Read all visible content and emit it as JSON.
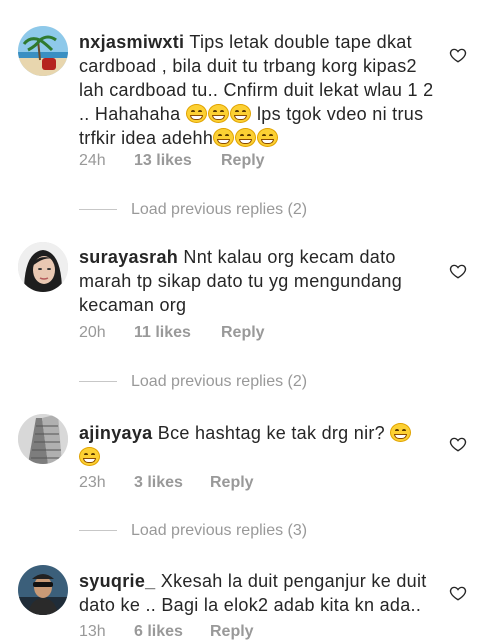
{
  "comments": [
    {
      "username": "nxjasmiwxti",
      "segments": [
        "Tips letak double tape dkat cardboad , bila duit tu trbang korg kipas2 lah cardboad tu.. Cnfirm duit lekat wlau 1 2 .. Hahahaha ",
        "emoji",
        "emoji",
        "emoji",
        " lps tgok vdeo ni trus trfkir idea adehh",
        "emoji",
        "emoji",
        "emoji"
      ],
      "time": "24h",
      "likes": "13 likes",
      "reply": "Reply",
      "avatar_icon": "beach-photo-avatar"
    },
    {
      "username": "surayasrah",
      "segments": [
        "Nnt kalau org kecam dato marah tp sikap dato tu yg mengundang kecaman org"
      ],
      "time": "20h",
      "likes": "11 likes",
      "reply": "Reply",
      "avatar_icon": "woman-portrait-avatar"
    },
    {
      "username": "ajinyaya",
      "segments": [
        "Bce hashtag ke tak drg nir? ",
        "emoji",
        " ",
        "emoji"
      ],
      "time": "23h",
      "likes": "3 likes",
      "reply": "Reply",
      "avatar_icon": "building-photo-avatar"
    },
    {
      "username": "syuqrie_",
      "segments": [
        "Xkesah la duit penganjur ke duit dato ke .. Bagi la elok2 adab kita kn ada.."
      ],
      "time": "13h",
      "likes": "6 likes",
      "reply": "Reply",
      "avatar_icon": "man-photo-avatar"
    }
  ],
  "load_previous": [
    "Load previous replies (2)",
    "Load previous replies (2)",
    "Load previous replies (3)"
  ],
  "icons": {
    "like": "heart-outline-icon",
    "emoji": "grinning-face-emoji"
  },
  "colors": {
    "text": "#262626",
    "meta": "#999999",
    "emoji": "#fcd033"
  }
}
